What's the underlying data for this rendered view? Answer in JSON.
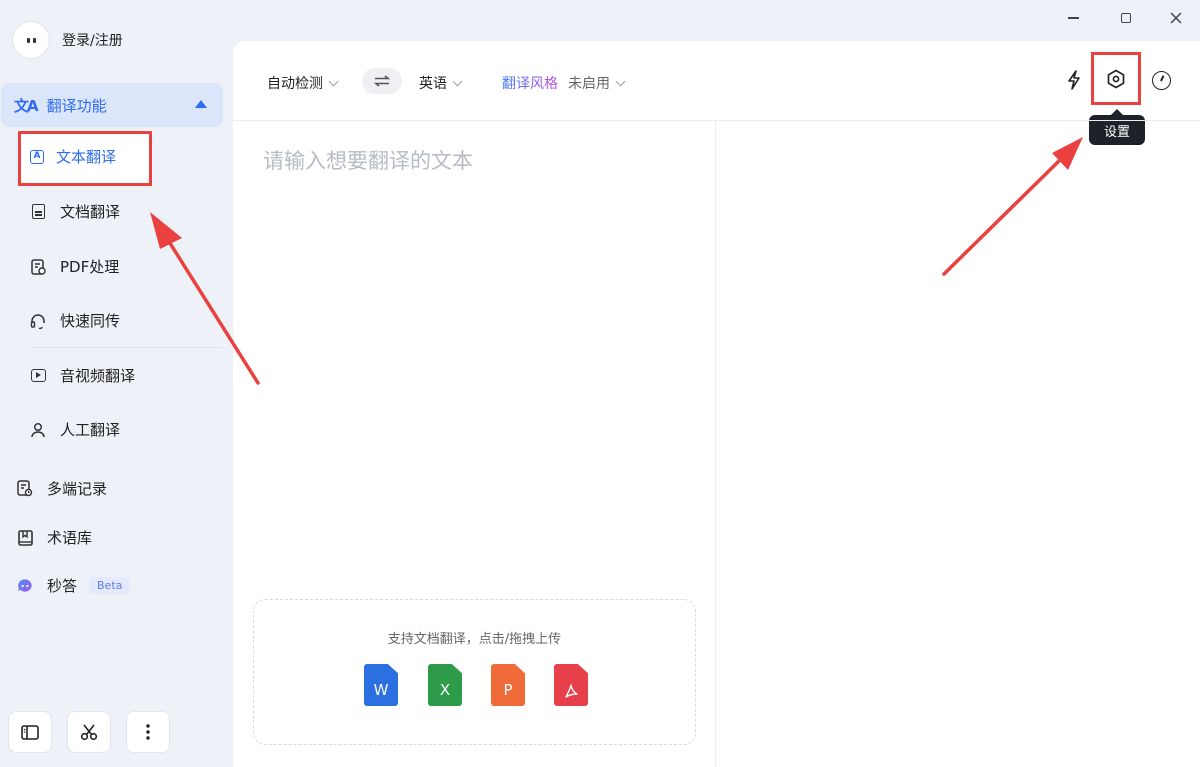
{
  "user": {
    "login_label": "登录/注册"
  },
  "sidebar": {
    "group_label": "翻译功能",
    "sub_items": [
      {
        "label": "文本翻译",
        "icon": "text-translate-icon"
      },
      {
        "label": "文档翻译",
        "icon": "document-icon"
      },
      {
        "label": "PDF处理",
        "icon": "pdf-icon"
      },
      {
        "label": "快速同传",
        "icon": "headset-icon"
      },
      {
        "label": "音视频翻译",
        "icon": "video-icon"
      },
      {
        "label": "人工翻译",
        "icon": "person-icon"
      }
    ],
    "top_items": [
      {
        "label": "多端记录",
        "icon": "record-icon"
      },
      {
        "label": "术语库",
        "icon": "book-icon"
      },
      {
        "label": "秒答",
        "icon": "chat-bot-icon",
        "badge": "Beta"
      }
    ]
  },
  "toolbar": {
    "source_lang": "自动检测",
    "target_lang": "英语",
    "style_label": "翻译风格",
    "style_value": "未启用",
    "settings_tooltip": "设置"
  },
  "editor": {
    "placeholder": "请输入想要翻译的文本"
  },
  "upload": {
    "hint": "支持文档翻译，点击/拖拽上传",
    "types": [
      "W",
      "X",
      "P"
    ]
  },
  "colors": {
    "accent": "#2f6bf0",
    "highlight": "#ea4040"
  }
}
